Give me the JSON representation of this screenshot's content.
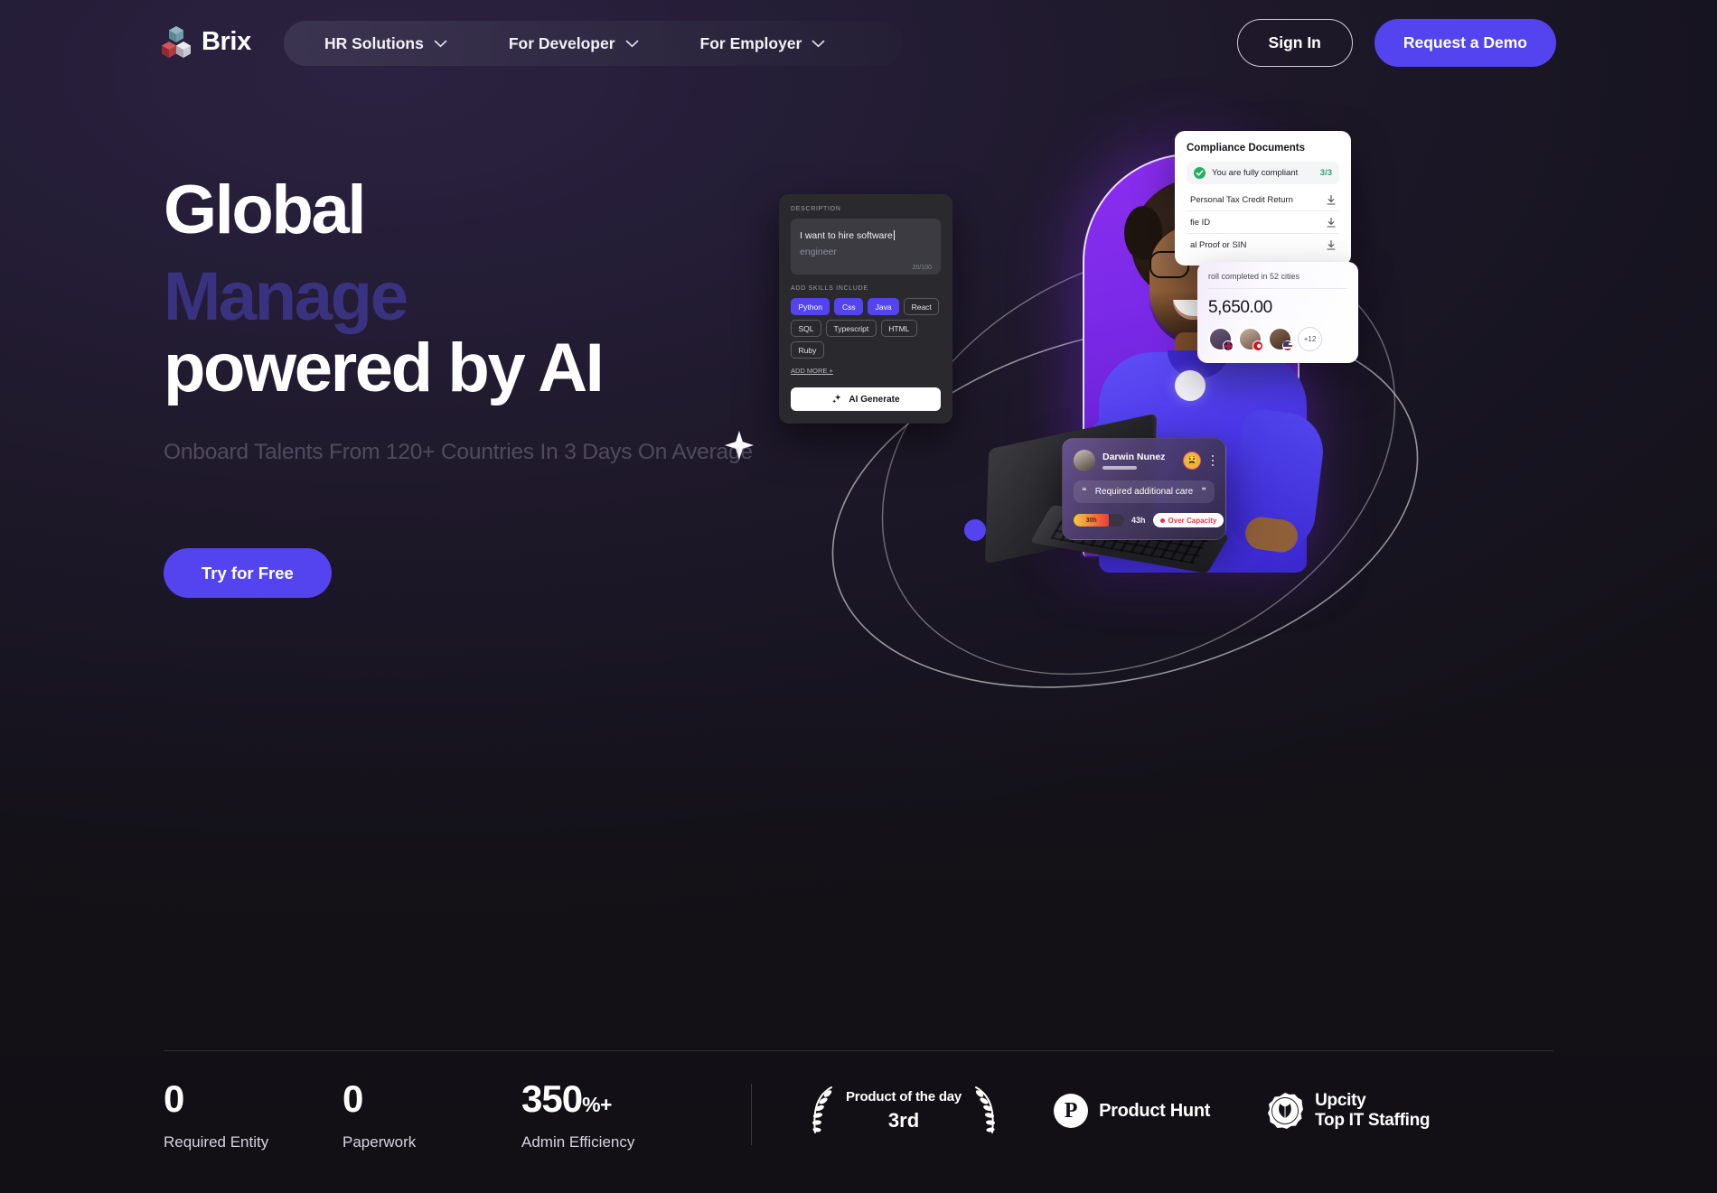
{
  "brand": {
    "name": "Brix",
    "logo_icon": "cubes-logo-icon",
    "accent": "#5344f0"
  },
  "nav": {
    "items": [
      {
        "label": "HR Solutions",
        "icon": "chevron-down-icon"
      },
      {
        "label": "For Developer",
        "icon": "chevron-down-icon"
      },
      {
        "label": "For Employer",
        "icon": "chevron-down-icon"
      }
    ],
    "sign_in": "Sign In",
    "request_demo": "Request a Demo"
  },
  "hero": {
    "line1": "Global",
    "line2_rotating": "Manage",
    "line3": "powered by AI",
    "subtitle": "Onboard Talents From 120+ Countries In 3 Days On Average",
    "cta": "Try for Free"
  },
  "cards": {
    "ai": {
      "label": "DESCRIPTION",
      "typed_text": "I want to hire software",
      "ghost_text": " engineer",
      "counter": "20/100",
      "skills_label": "ADD SKILLS INCLUDE",
      "skills": [
        {
          "name": "Python",
          "selected": true
        },
        {
          "name": "Css",
          "selected": true
        },
        {
          "name": "Java",
          "selected": true
        },
        {
          "name": "React",
          "selected": false
        },
        {
          "name": "SQL",
          "selected": false
        },
        {
          "name": "Typescript",
          "selected": false
        },
        {
          "name": "HTML",
          "selected": false
        },
        {
          "name": "Ruby",
          "selected": false
        }
      ],
      "add_more": "ADD MORE +",
      "generate_button": "AI Generate",
      "generate_icon": "sparkle-icon"
    },
    "compliance": {
      "title": "Compliance Documents",
      "status_text": "You are fully compliant",
      "status_count": "3/3",
      "status_icon": "check-circle-icon",
      "documents": [
        {
          "name": "Personal Tax Credit Return",
          "icon": "download-icon"
        },
        {
          "name": "fie ID",
          "icon": "download-icon"
        },
        {
          "name": "al Proof or SIN",
          "icon": "download-icon"
        }
      ]
    },
    "payroll": {
      "subtitle": "roll completed in 52 cities",
      "amount": "5,650.00",
      "avatars": [
        {
          "flag": "flag-uk-icon"
        },
        {
          "flag": "flag-red-icon"
        },
        {
          "flag": "flag-us-icon"
        }
      ],
      "overflow": "+12"
    },
    "darwin": {
      "name": "Darwin Nunez",
      "emoji": "😫",
      "menu_icon": "kebab-menu-icon",
      "quote": "Required additional care",
      "quote_open_icon": "quote-open-icon",
      "quote_close_icon": "quote-close-icon",
      "hours_used": "30h",
      "hours_total": "43h",
      "capacity_badge": "Over Capacity",
      "capacity_color": "#e3354d"
    }
  },
  "footer": {
    "stats": [
      {
        "value": "0",
        "suffix": "",
        "label": "Required Entity"
      },
      {
        "value": "0",
        "suffix": "",
        "label": "Paperwork"
      },
      {
        "value": "350",
        "suffix": "%+",
        "label": "Admin Efficiency"
      }
    ],
    "awards": [
      {
        "type": "laurel",
        "title": "Product of the day",
        "rank": "3rd",
        "icon": "laurel-wreath-icon"
      },
      {
        "type": "producthunt",
        "label": "Product Hunt",
        "icon": "product-hunt-icon"
      },
      {
        "type": "upcity",
        "line1": "Upcity",
        "line2": "Top IT Staffing",
        "icon": "upcity-seal-icon"
      }
    ]
  }
}
